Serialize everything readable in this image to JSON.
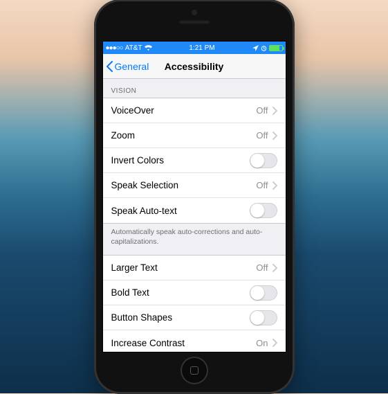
{
  "status": {
    "signal_dots": "●●●○○",
    "carrier": "AT&T",
    "time": "1:21 PM"
  },
  "nav": {
    "back_label": "General",
    "title": "Accessibility"
  },
  "sections": {
    "vision_header": "VISION",
    "footer1": "Automatically speak auto-corrections and auto-capitalizations."
  },
  "rows": {
    "voiceover": {
      "label": "VoiceOver",
      "value": "Off"
    },
    "zoom": {
      "label": "Zoom",
      "value": "Off"
    },
    "invert": {
      "label": "Invert Colors"
    },
    "speak_selection": {
      "label": "Speak Selection",
      "value": "Off"
    },
    "speak_autotext": {
      "label": "Speak Auto-text"
    },
    "larger_text": {
      "label": "Larger Text",
      "value": "Off"
    },
    "bold_text": {
      "label": "Bold Text"
    },
    "button_shapes": {
      "label": "Button Shapes"
    },
    "increase_contrast": {
      "label": "Increase Contrast",
      "value": "On"
    }
  }
}
